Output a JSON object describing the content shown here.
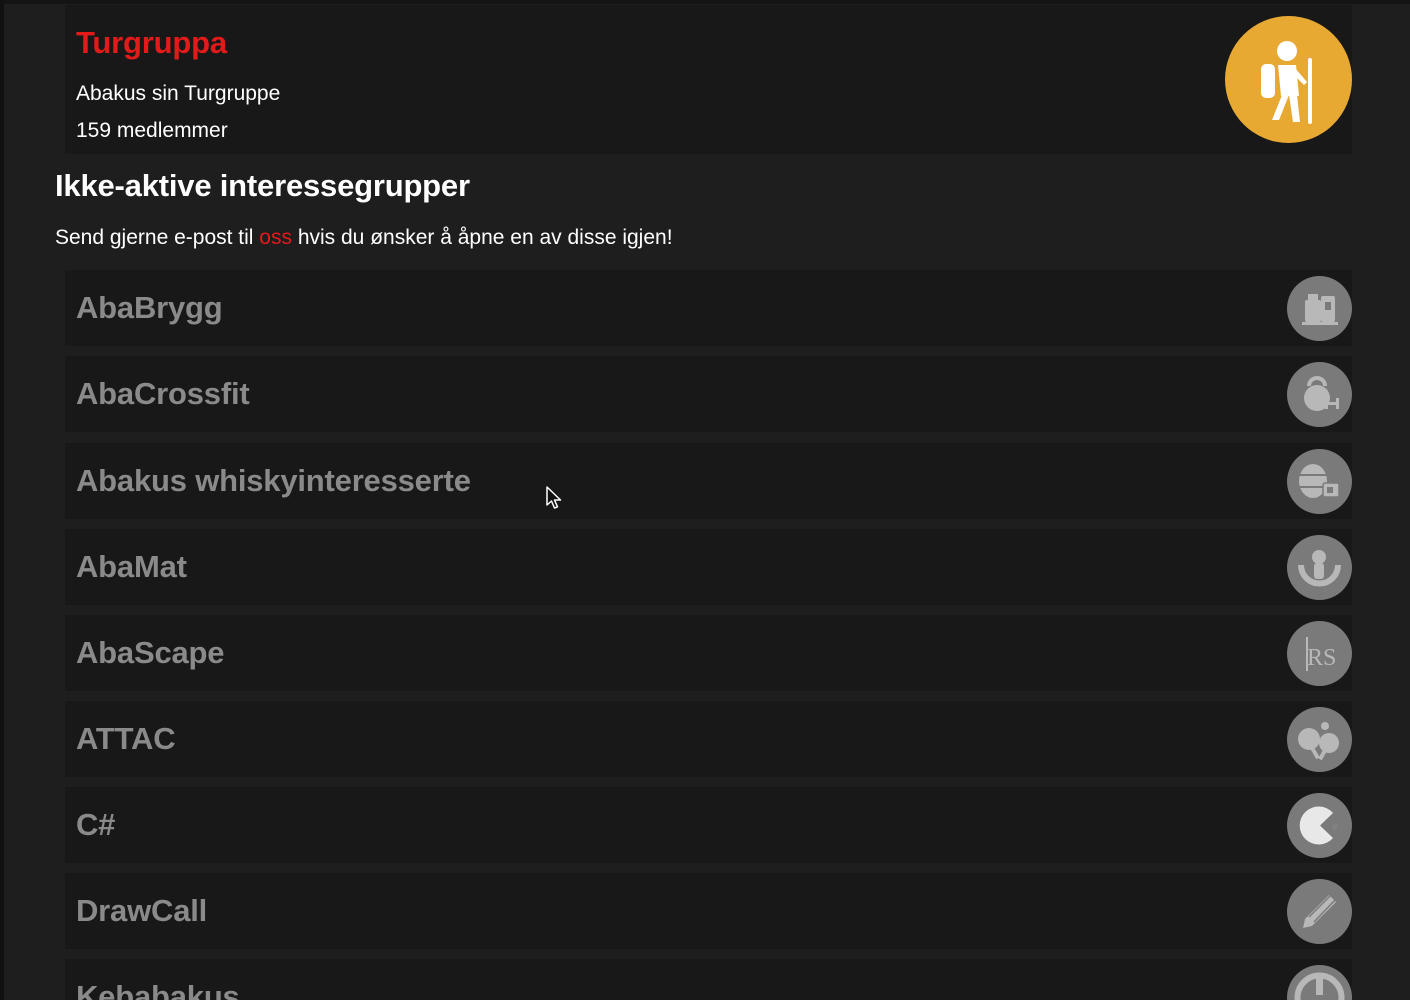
{
  "active_group": {
    "title": "Turgruppa",
    "description": "Abakus sin Turgruppe",
    "members": "159 medlemmer",
    "logo_icon": "hiker-icon",
    "logo_color": "#e8a933"
  },
  "inactive_section": {
    "heading": "Ikke-aktive interessegrupper",
    "text_before": "Send gjerne e-post til ",
    "link_text": "oss",
    "text_after": " hvis du ønsker å åpne en av disse igjen!"
  },
  "inactive_groups": [
    {
      "name": "AbaBrygg",
      "icon": "brewing-icon"
    },
    {
      "name": "AbaCrossfit",
      "icon": "kettlebell-icon"
    },
    {
      "name": "Abakus whiskyinteresserte",
      "icon": "barrel-icon"
    },
    {
      "name": "AbaMat",
      "icon": "chef-icon"
    },
    {
      "name": "AbaScape",
      "icon": "runescape-icon"
    },
    {
      "name": "ATTAC",
      "icon": "table-tennis-icon"
    },
    {
      "name": "C#",
      "icon": "csharp-icon"
    },
    {
      "name": "DrawCall",
      "icon": "pencil-icon"
    },
    {
      "name": "Kebabakus",
      "icon": "kebab-icon"
    }
  ],
  "colors": {
    "background": "#1e1e1e",
    "card": "#181818",
    "accent_red": "#e21a1a",
    "inactive_text": "#8a8a8a",
    "inactive_logo": "#7a7a7a"
  }
}
